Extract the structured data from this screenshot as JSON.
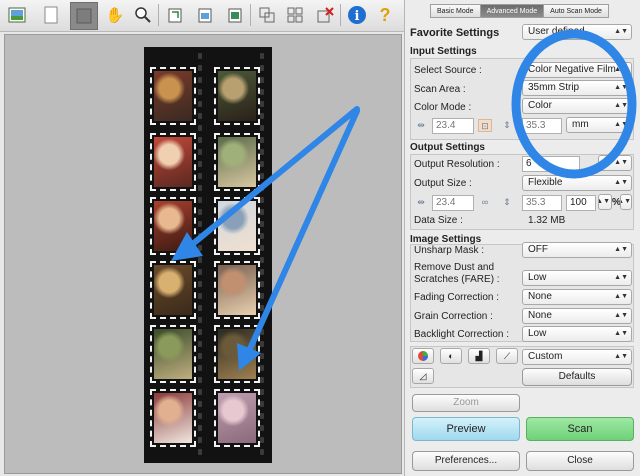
{
  "tabs": [
    "Basic Mode",
    "Advanced Mode",
    "Auto Scan Mode"
  ],
  "favorite": {
    "label": "Favorite Settings",
    "value": "User defined"
  },
  "input_settings": {
    "title": "Input Settings",
    "select_source": {
      "label": "Select Source :",
      "value": "Color Negative Film"
    },
    "scan_area": {
      "label": "Scan Area :",
      "value": "35mm Strip"
    },
    "color_mode": {
      "label": "Color Mode :",
      "value": "Color"
    },
    "width": "23.4",
    "height": "35.3",
    "unit": "mm"
  },
  "output_settings": {
    "title": "Output Settings",
    "resolution": {
      "label": "Output Resolution :",
      "value": "6"
    },
    "size": {
      "label": "Output Size :",
      "value": "Flexible"
    },
    "width": "23.4",
    "height": "35.3",
    "scale": "100",
    "scale_unit": "%",
    "data_size": {
      "label": "Data Size :",
      "value": "1.32 MB"
    }
  },
  "image_settings": {
    "title": "Image Settings",
    "unsharp": {
      "label": "Unsharp Mask :",
      "value": "OFF"
    },
    "dust_line1": "Remove Dust and",
    "dust_line2": "Scratches (FARE) :",
    "dust_value": "Low",
    "fading": {
      "label": "Fading Correction :",
      "value": "None"
    },
    "grain": {
      "label": "Grain Correction :",
      "value": "None"
    },
    "backlight": {
      "label": "Backlight Correction :",
      "value": "Low"
    }
  },
  "color_settings": {
    "value": "Custom",
    "defaults_label": "Defaults"
  },
  "buttons": {
    "zoom": "Zoom",
    "preview": "Preview",
    "scan": "Scan",
    "preferences": "Preferences...",
    "close": "Close"
  },
  "colors": {
    "annotation_blue": "#2f86e6",
    "scan_green": "#6ed277",
    "preview_blue": "#a9dcf0",
    "active_tab": "#7a7a7a"
  },
  "toolbar_icons": [
    "thumbnail-icon",
    "page-icon",
    "crop-frame-icon",
    "hand-icon",
    "zoom-icon",
    "rotate-left-icon",
    "rotate-right-icon",
    "mirror-icon",
    "crop-icon",
    "multi-crop-icon",
    "clear-crop-icon",
    "info-icon",
    "help-icon"
  ]
}
